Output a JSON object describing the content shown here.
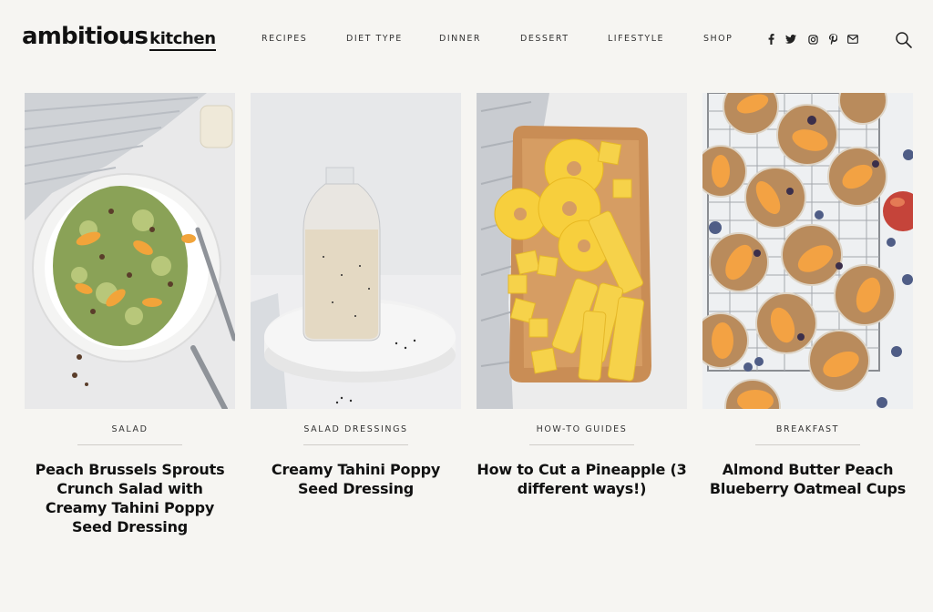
{
  "brand": {
    "name_main": "ambitious",
    "name_sub": "kitchen"
  },
  "nav": {
    "items": [
      "RECIPES",
      "DIET TYPE",
      "DINNER",
      "DESSERT",
      "LIFESTYLE",
      "SHOP"
    ]
  },
  "social": {
    "icons": [
      "facebook-icon",
      "twitter-icon",
      "instagram-icon",
      "pinterest-icon",
      "email-icon"
    ]
  },
  "search": {
    "icon": "search-icon"
  },
  "posts": [
    {
      "category": "SALAD",
      "title": "Peach Brussels Sprouts Crunch Salad with Creamy Tahini Poppy Seed Dressing"
    },
    {
      "category": "SALAD DRESSINGS",
      "title": "Creamy Tahini Poppy Seed Dressing"
    },
    {
      "category": "HOW-TO GUIDES",
      "title": "How to Cut a Pineapple (3 different ways!)"
    },
    {
      "category": "BREAKFAST",
      "title": "Almond Butter Peach Blueberry Oatmeal Cups"
    }
  ]
}
